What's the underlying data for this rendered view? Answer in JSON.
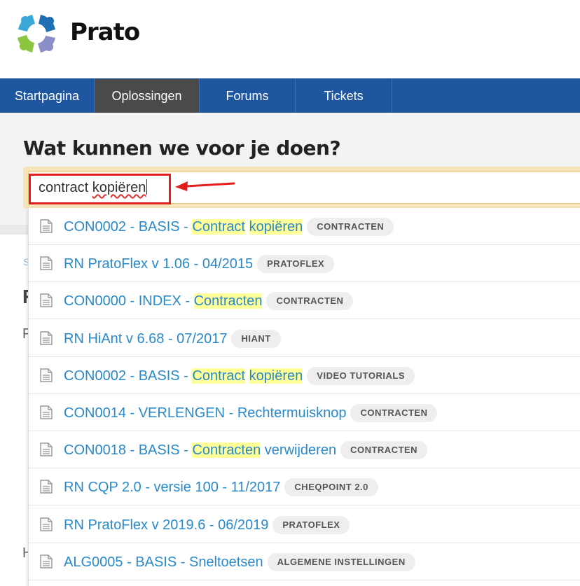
{
  "brand": {
    "name": "Prato"
  },
  "nav": {
    "items": [
      {
        "label": "Startpagina"
      },
      {
        "label": "Oplossingen"
      },
      {
        "label": "Forums"
      },
      {
        "label": "Tickets"
      }
    ],
    "active_index": 1
  },
  "search": {
    "heading": "Wat kunnen we voor je doen?",
    "value_plain": "contract ",
    "value_misspelled": "kopiëren"
  },
  "results": [
    {
      "title_parts": [
        "CON0002 - BASIS - ",
        "Contract",
        " ",
        "kopiëren",
        ""
      ],
      "tag": "CONTRACTEN"
    },
    {
      "title_parts": [
        "RN PratoFlex v 1.06 - 04/2015"
      ],
      "tag": "PRATOFLEX"
    },
    {
      "title_parts": [
        "CON0000 - INDEX - ",
        "Contracten",
        ""
      ],
      "tag": "CONTRACTEN"
    },
    {
      "title_parts": [
        "RN HiAnt v 6.68 - 07/2017"
      ],
      "tag": "HIANT"
    },
    {
      "title_parts": [
        "CON0002 - BASIS - ",
        "Contract",
        " ",
        "kopiëren",
        ""
      ],
      "tag": "VIDEO TUTORIALS"
    },
    {
      "title_parts": [
        "CON0014 - VERLENGEN - Rechtermuisknop"
      ],
      "tag": "CONTRACTEN"
    },
    {
      "title_parts": [
        "CON0018 - BASIS - ",
        "Contracten",
        " verwijderen"
      ],
      "tag": "CONTRACTEN"
    },
    {
      "title_parts": [
        "RN CQP 2.0 - versie 100 - 11/2017"
      ],
      "tag": "CHEQPOINT 2.0"
    },
    {
      "title_parts": [
        "RN PratoFlex v 2019.6 - 06/2019"
      ],
      "tag": "PRATOFLEX"
    },
    {
      "title_parts": [
        "ALG0005 - BASIS - Sneltoetsen"
      ],
      "tag": "ALGEMENE INSTELLINGEN"
    }
  ],
  "colors": {
    "nav_bg": "#1e56a0",
    "nav_active": "#4a4a4a",
    "link": "#2a8ac9",
    "highlight": "#ffff99",
    "annotation_red": "#e31c1c"
  }
}
